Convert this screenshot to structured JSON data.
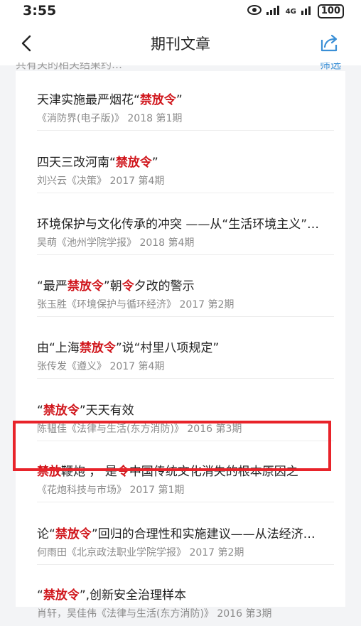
{
  "status_bar": {
    "time": "3:55",
    "network": "4G",
    "battery": "100"
  },
  "navbar": {
    "title": "期刊文章"
  },
  "list_header": {
    "left_text": "共有关的相关结果约…",
    "right_text": "筛选"
  },
  "articles": [
    {
      "parts": [
        {
          "text": "天津实施最严烟花“"
        },
        {
          "text": "禁放令",
          "hl": true
        },
        {
          "text": "”"
        }
      ],
      "meta": "《消防界(电子版)》 2018 第1期"
    },
    {
      "parts": [
        {
          "text": "四天三改河南“"
        },
        {
          "text": "禁放令",
          "hl": true
        },
        {
          "text": "”"
        }
      ],
      "meta": "刘兴云《决策》 2017 第4期"
    },
    {
      "parts": [
        {
          "text": "环境保护与文化传承的冲突 ——从“生活环境主义”…"
        }
      ],
      "meta": "吴萌《池州学院学报》 2018 第4期"
    },
    {
      "parts": [
        {
          "text": "“最严"
        },
        {
          "text": "禁放令",
          "hl": true
        },
        {
          "text": "”朝"
        },
        {
          "text": "令",
          "hl": true
        },
        {
          "text": "夕改的警示"
        }
      ],
      "meta": "张玉胜《环境保护与循环经济》 2017 第2期"
    },
    {
      "parts": [
        {
          "text": "由“上海"
        },
        {
          "text": "禁放令",
          "hl": true
        },
        {
          "text": "”说“村里八项规定”"
        }
      ],
      "meta": "张传发《遵义》 2017 第4期"
    },
    {
      "parts": [
        {
          "text": "“"
        },
        {
          "text": "禁放令",
          "hl": true
        },
        {
          "text": "”天天有效"
        }
      ],
      "meta": "陈韫佳《法律与生活(东方消防)》 2016 第3期"
    },
    {
      "parts": [
        {
          "text": "禁放",
          "hl": true
        },
        {
          "text": "鞭炮 ， 是"
        },
        {
          "text": "令",
          "hl": true
        },
        {
          "text": "中国传统文化消失的根本原因之一"
        }
      ],
      "meta": "《花炮科技与市场》 2017 第1期"
    },
    {
      "parts": [
        {
          "text": "论“"
        },
        {
          "text": "禁放令",
          "hl": true
        },
        {
          "text": "”回归的合理性和实施建议——从法经济…"
        }
      ],
      "meta": "何雨田《北京政法职业学院学报》 2017 第2期"
    },
    {
      "parts": [
        {
          "text": "“"
        },
        {
          "text": "禁放令",
          "hl": true
        },
        {
          "text": "”,创新安全治理样本"
        }
      ],
      "meta": "肖轩，吴佳伟《法律与生活(东方消防)》 2016 第3期"
    }
  ]
}
